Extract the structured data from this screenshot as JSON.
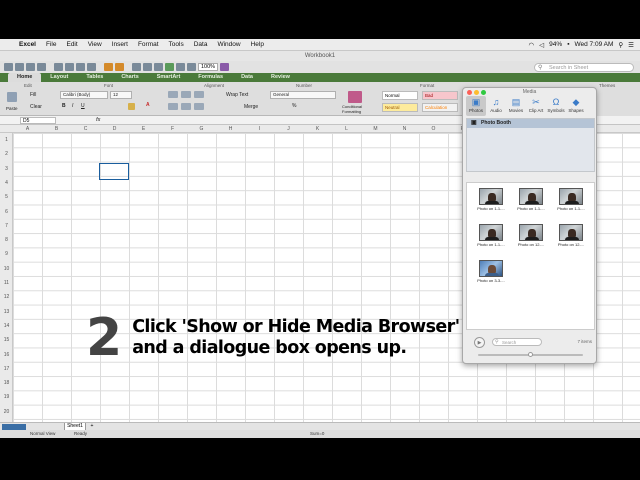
{
  "menubar": {
    "app": "Excel",
    "items": [
      "File",
      "Edit",
      "View",
      "Insert",
      "Format",
      "Tools",
      "Data",
      "Window",
      "Help"
    ],
    "battery": "94%",
    "clock": "Wed 7:09 AM"
  },
  "window": {
    "title": "Workbook1"
  },
  "toolbar": {
    "zoom": "100%",
    "search_placeholder": "Search in Sheet"
  },
  "ribbon_tabs": [
    "Home",
    "Layout",
    "Tables",
    "Charts",
    "SmartArt",
    "Formulas",
    "Data",
    "Review"
  ],
  "ribbon": {
    "groups": {
      "edit": "Edit",
      "font": "Font",
      "alignment": "Alignment",
      "number": "Number",
      "format": "Format",
      "themes": "Themes"
    },
    "paste": "Paste",
    "fill": "Fill",
    "clear": "Clear",
    "font_name": "Calibri (Body)",
    "font_size": "12",
    "wrap_text": "Wrap Text",
    "merge": "Merge",
    "number_format": "General",
    "conditional_formatting": "Conditional Formatting",
    "styles": {
      "normal": "Normal",
      "bad": "Bad",
      "neutral": "Neutral",
      "calculation": "Calculation"
    },
    "themes_label": "Themes"
  },
  "formula_bar": {
    "name_box": "D5",
    "fx": "fx"
  },
  "grid": {
    "columns": [
      "A",
      "B",
      "C",
      "D",
      "E",
      "F",
      "G",
      "H",
      "I",
      "J",
      "K",
      "L",
      "M",
      "N",
      "O",
      "P",
      "Q"
    ],
    "rows": [
      "1",
      "2",
      "3",
      "4",
      "5",
      "6",
      "7",
      "8",
      "9",
      "10",
      "11",
      "12",
      "13",
      "14",
      "15",
      "16",
      "17",
      "18",
      "19",
      "20"
    ]
  },
  "overlay": {
    "step_number": "2",
    "line1": "Click 'Show or Hide Media Browser'",
    "line2": "and a dialogue box opens up."
  },
  "sheets": {
    "active": "Sheet1",
    "add": "+"
  },
  "status": {
    "view": "Normal View",
    "ready": "Ready",
    "sum": "Sum=0"
  },
  "media_browser": {
    "title": "Media",
    "tabs": [
      {
        "label": "Photos",
        "icon": "photos-icon",
        "glyph": "▣"
      },
      {
        "label": "Audio",
        "icon": "audio-icon",
        "glyph": "♫"
      },
      {
        "label": "Movies",
        "icon": "movies-icon",
        "glyph": "▤"
      },
      {
        "label": "Clip Art",
        "icon": "clip-art-icon",
        "glyph": "✂"
      },
      {
        "label": "Symbols",
        "icon": "symbols-icon",
        "glyph": "Ω"
      },
      {
        "label": "Shapes",
        "icon": "shapes-icon",
        "glyph": "◆"
      }
    ],
    "source": "Photo Booth",
    "photos": [
      {
        "caption": "Photo on 1-1-..."
      },
      {
        "caption": "Photo on 1-1-..."
      },
      {
        "caption": "Photo on 1-1-..."
      },
      {
        "caption": "Photo on 1-1-..."
      },
      {
        "caption": "Photo on 12-..."
      },
      {
        "caption": "Photo on 12-..."
      },
      {
        "caption": "Photo on 3-3-..."
      }
    ],
    "search_placeholder": "Search",
    "item_count": "7 items"
  }
}
